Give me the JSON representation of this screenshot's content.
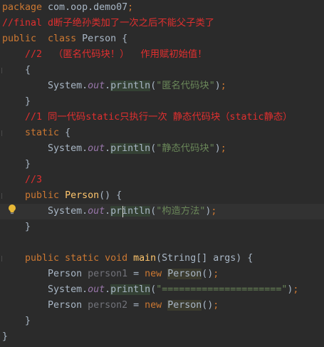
{
  "editor": {
    "lines": [
      {
        "segments": [
          {
            "t": "package ",
            "c": "kw"
          },
          {
            "t": "com.oop.demo07",
            "c": ""
          },
          {
            "t": ";",
            "c": "kw"
          }
        ]
      },
      {
        "segments": [
          {
            "t": "//final d断子绝孙类加了一次之后不能父子类了",
            "c": "cm"
          }
        ]
      },
      {
        "segments": [
          {
            "t": "public  class ",
            "c": "kw"
          },
          {
            "t": "Person {",
            "c": ""
          }
        ]
      },
      {
        "segments": [
          {
            "t": "    //2  （匿名代码块！）  作用赋初始值！",
            "c": "cm"
          }
        ]
      },
      {
        "segments": [
          {
            "t": "    {",
            "c": ""
          }
        ]
      },
      {
        "segments": [
          {
            "t": "        System.",
            "c": ""
          },
          {
            "t": "out",
            "c": "fld"
          },
          {
            "t": ".",
            "c": ""
          },
          {
            "t": "println",
            "c": "hlg"
          },
          {
            "t": "(",
            "c": ""
          },
          {
            "t": "\"匿名代码块\"",
            "c": "st"
          },
          {
            "t": ")",
            "c": ""
          },
          {
            "t": ";",
            "c": "kw"
          }
        ]
      },
      {
        "segments": [
          {
            "t": "    }",
            "c": ""
          }
        ]
      },
      {
        "segments": [
          {
            "t": "    //1 同一代码static只执行一次 静态代码块（static静态）",
            "c": "cm"
          }
        ]
      },
      {
        "segments": [
          {
            "t": "    static ",
            "c": "kw"
          },
          {
            "t": "{",
            "c": ""
          }
        ]
      },
      {
        "segments": [
          {
            "t": "        System.",
            "c": ""
          },
          {
            "t": "out",
            "c": "fld"
          },
          {
            "t": ".",
            "c": ""
          },
          {
            "t": "println",
            "c": "hlg"
          },
          {
            "t": "(",
            "c": ""
          },
          {
            "t": "\"静态代码块\"",
            "c": "st"
          },
          {
            "t": ")",
            "c": ""
          },
          {
            "t": ";",
            "c": "kw"
          }
        ]
      },
      {
        "segments": [
          {
            "t": "    }",
            "c": ""
          }
        ]
      },
      {
        "segments": [
          {
            "t": "    //3",
            "c": "cm"
          }
        ]
      },
      {
        "segments": [
          {
            "t": "    public ",
            "c": "kw"
          },
          {
            "t": "Person",
            "c": "fn"
          },
          {
            "t": "() {",
            "c": ""
          }
        ]
      },
      {
        "current": true,
        "segments": [
          {
            "t": "        System.",
            "c": ""
          },
          {
            "t": "out",
            "c": "fld"
          },
          {
            "t": ".",
            "c": ""
          },
          {
            "t": "println",
            "c": "hlg"
          },
          {
            "t": "(",
            "c": ""
          },
          {
            "t": "\"构造方法\"",
            "c": "st"
          },
          {
            "t": ")",
            "c": ""
          },
          {
            "t": ";",
            "c": "kw"
          }
        ]
      },
      {
        "segments": [
          {
            "t": "    }",
            "c": ""
          }
        ]
      },
      {
        "segments": [
          {
            "t": "",
            "c": ""
          }
        ]
      },
      {
        "segments": [
          {
            "t": "    public static void ",
            "c": "kw"
          },
          {
            "t": "main",
            "c": "fn"
          },
          {
            "t": "(String[] args) {",
            "c": ""
          }
        ]
      },
      {
        "segments": [
          {
            "t": "        Person ",
            "c": ""
          },
          {
            "t": "person1",
            "c": "unused"
          },
          {
            "t": " = ",
            "c": ""
          },
          {
            "t": "new ",
            "c": "kw"
          },
          {
            "t": "Person",
            "c": "hlc"
          },
          {
            "t": "()",
            "c": ""
          },
          {
            "t": ";",
            "c": "kw"
          }
        ]
      },
      {
        "segments": [
          {
            "t": "        System.",
            "c": ""
          },
          {
            "t": "out",
            "c": "fld"
          },
          {
            "t": ".",
            "c": ""
          },
          {
            "t": "println",
            "c": "hlg"
          },
          {
            "t": "(",
            "c": ""
          },
          {
            "t": "\"=====================\"",
            "c": "st"
          },
          {
            "t": ")",
            "c": ""
          },
          {
            "t": ";",
            "c": "kw"
          }
        ]
      },
      {
        "segments": [
          {
            "t": "        Person ",
            "c": ""
          },
          {
            "t": "person2",
            "c": "unused"
          },
          {
            "t": " = ",
            "c": ""
          },
          {
            "t": "new ",
            "c": "kw"
          },
          {
            "t": "Person",
            "c": "hlc"
          },
          {
            "t": "()",
            "c": ""
          },
          {
            "t": ";",
            "c": "kw"
          }
        ]
      },
      {
        "segments": [
          {
            "t": "    }",
            "c": ""
          }
        ]
      },
      {
        "segments": [
          {
            "t": "}",
            "c": ""
          }
        ]
      }
    ]
  },
  "colors": {
    "background": "#2b2b2b",
    "keyword": "#cc7832",
    "comment": "#e02f2f",
    "string": "#6a8759",
    "method": "#ffc66d",
    "field": "#9876aa"
  },
  "icons": {
    "intention": "lightbulb-icon"
  }
}
